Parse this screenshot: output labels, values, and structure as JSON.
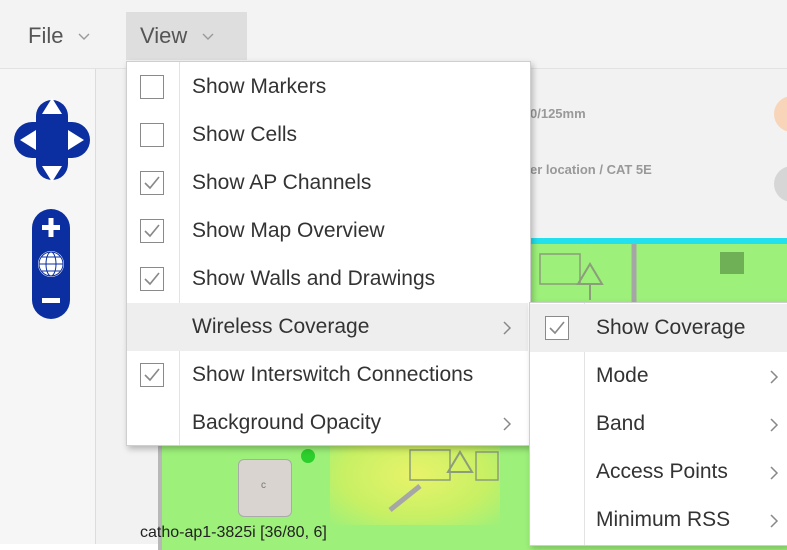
{
  "menubar": {
    "file_label": "File",
    "view_label": "View"
  },
  "map": {
    "header_line1": "0/125mm",
    "header_line2": "er location / CAT 5E",
    "ap_label": "catho-ap1-3825i [36/80, 6]",
    "ap_icon_text": "c"
  },
  "view_menu": {
    "items": [
      {
        "label": "Show Markers",
        "checked": false
      },
      {
        "label": "Show Cells",
        "checked": false
      },
      {
        "label": "Show AP Channels",
        "checked": true
      },
      {
        "label": "Show Map Overview",
        "checked": true
      },
      {
        "label": "Show Walls and Drawings",
        "checked": true
      },
      {
        "label": "Wireless Coverage",
        "submenu": true
      },
      {
        "label": "Show Interswitch Connections",
        "checked": true
      },
      {
        "label": "Background Opacity",
        "submenu": true
      }
    ]
  },
  "coverage_submenu": {
    "items": [
      {
        "label": "Show Coverage",
        "checked": true
      },
      {
        "label": "Mode",
        "submenu": true
      },
      {
        "label": "Band",
        "submenu": true
      },
      {
        "label": "Access Points",
        "submenu": true
      },
      {
        "label": "Minimum RSS",
        "submenu": true
      }
    ]
  },
  "colors": {
    "control_blue": "#0b2fa0",
    "coverage_green": "#9df07a",
    "floor_border_cyan": "#22e0ee"
  }
}
